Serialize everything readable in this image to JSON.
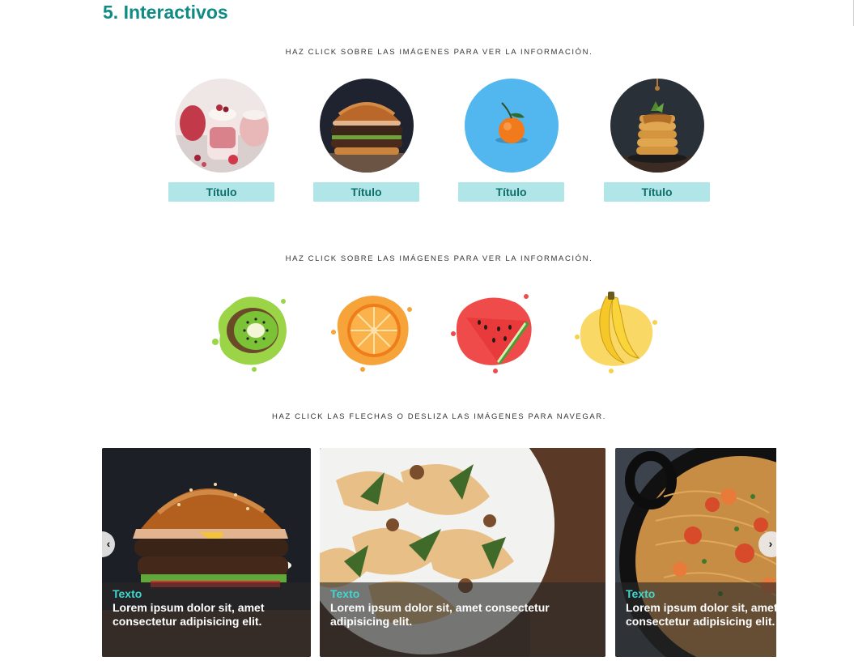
{
  "section": {
    "title": "5. Interactivos"
  },
  "instructions": {
    "first": "Haz click sobre las imágenes para ver la información.",
    "second": "Haz click sobre las imágenes para ver la información.",
    "third": "Haz click las flechas o desliza las imágenes para navegar."
  },
  "circle_cards": [
    {
      "image": "berry-dessert-jars-photo",
      "button_label": "Título"
    },
    {
      "image": "burger-photo",
      "button_label": "Título"
    },
    {
      "image": "orange-on-blue-photo",
      "button_label": "Título"
    },
    {
      "image": "pancakes-photo",
      "button_label": "Título"
    }
  ],
  "fruits": [
    {
      "image": "kiwi-splash"
    },
    {
      "image": "orange-splash"
    },
    {
      "image": "watermelon-splash"
    },
    {
      "image": "banana-splash"
    }
  ],
  "carousel": {
    "slides": [
      {
        "image": "burger-photo",
        "title": "Texto",
        "text": "Lorem ipsum dolor sit, amet consectetur adipisicing elit."
      },
      {
        "image": "pasta-photo",
        "title": "Texto",
        "text": "Lorem ipsum dolor sit, amet consectetur adipisicing elit."
      },
      {
        "image": "seafood-spaghetti-pan-photo",
        "title": "Texto",
        "text": "Lorem ipsum dolor sit, amet consectetur adipisicing elit."
      }
    ],
    "prev_icon": "chevron-left-icon",
    "next_icon": "chevron-right-icon"
  },
  "colors": {
    "title": "#0f8a85",
    "button_bg": "#b1e6e8",
    "button_text": "#106e6b",
    "caption_title": "#40d6cf"
  }
}
